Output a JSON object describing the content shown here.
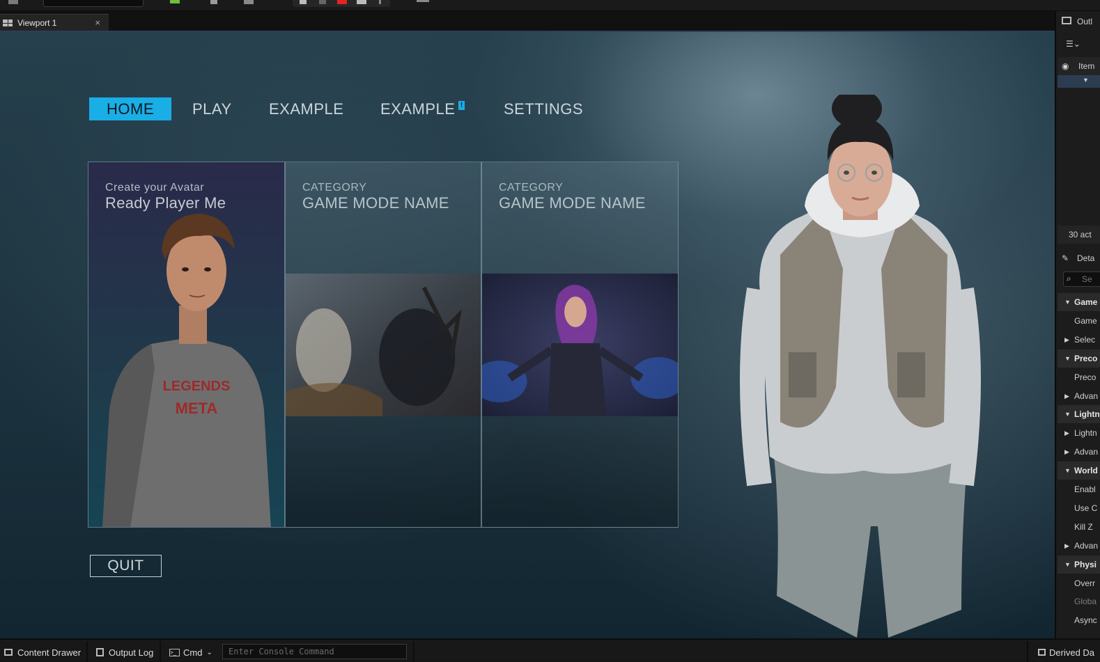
{
  "tab": {
    "label": "Viewport 1",
    "close": "×"
  },
  "menu": {
    "home": "HOME",
    "play": "PLAY",
    "example1": "EXAMPLE",
    "example2": "EXAMPLE",
    "example2_badge": "!",
    "settings": "SETTINGS"
  },
  "cards": [
    {
      "subtitle": "Create your Avatar",
      "title": "Ready Player Me"
    },
    {
      "subtitle": "CATEGORY",
      "title": "GAME MODE NAME"
    },
    {
      "subtitle": "CATEGORY",
      "title": "GAME MODE NAME"
    }
  ],
  "quit_label": "QUIT",
  "right_panel": {
    "outliner_title": "Outl",
    "column_label": "Item",
    "actor_count": "30 act",
    "details_title": "Deta",
    "search_placeholder": "Se",
    "rows": [
      {
        "label": "Game",
        "type": "category"
      },
      {
        "label": "Game",
        "type": "item"
      },
      {
        "label": "Selec",
        "type": "collapsed"
      },
      {
        "label": "Preco",
        "type": "category"
      },
      {
        "label": "Preco",
        "type": "item"
      },
      {
        "label": "Advan",
        "type": "collapsed"
      },
      {
        "label": "Lightn",
        "type": "category"
      },
      {
        "label": "Lightn",
        "type": "collapsed"
      },
      {
        "label": "Advan",
        "type": "collapsed"
      },
      {
        "label": "World",
        "type": "category"
      },
      {
        "label": "Enabl",
        "type": "item"
      },
      {
        "label": "Use C",
        "type": "item"
      },
      {
        "label": "Kill Z",
        "type": "item"
      },
      {
        "label": "Advan",
        "type": "collapsed"
      },
      {
        "label": "Physi",
        "type": "category"
      },
      {
        "label": "Overr",
        "type": "item"
      },
      {
        "label": "Globa",
        "type": "item-dim"
      },
      {
        "label": "Async",
        "type": "item"
      }
    ]
  },
  "bottom_bar": {
    "content_drawer": "Content Drawer",
    "output_log": "Output Log",
    "cmd": "Cmd",
    "console_placeholder": "Enter Console Command",
    "derived_data": "Derived Da"
  },
  "colors": {
    "accent": "#1aaee6"
  }
}
